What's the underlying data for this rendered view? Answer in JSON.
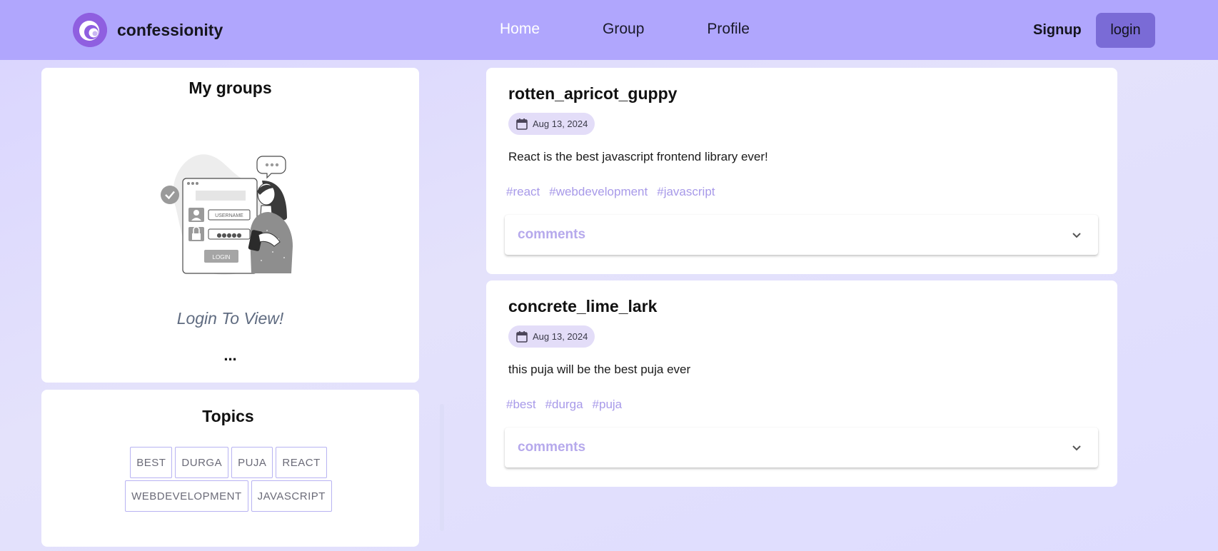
{
  "navbar": {
    "brand": "confessionity",
    "links": [
      {
        "label": "Home",
        "active": true
      },
      {
        "label": "Group",
        "active": false
      },
      {
        "label": "Profile",
        "active": false
      }
    ],
    "signup_label": "Signup",
    "login_label": "login",
    "logo_icon": "swirl-logo-icon"
  },
  "groups": {
    "title": "My groups",
    "illustration": {
      "username_text": "USERNAME",
      "password_mask": "●●●●●",
      "login_text": "LOGIN"
    },
    "message": "Login To View!",
    "more": "..."
  },
  "topics": {
    "title": "Topics",
    "items": [
      "BEST",
      "DURGA",
      "PUJA",
      "REACT",
      "WEBDEVELOPMENT",
      "JAVASCRIPT"
    ]
  },
  "posts": [
    {
      "username": "rotten_apricot_guppy",
      "date": "Aug 13, 2024",
      "text": "React is the best javascript frontend library ever!",
      "tags": [
        "#react",
        "#webdevelopment",
        "#javascript"
      ],
      "comments_label": "comments"
    },
    {
      "username": "concrete_lime_lark",
      "date": "Aug 13, 2024",
      "text": "this puja will be the best puja ever",
      "tags": [
        "#best",
        "#durga",
        "#puja"
      ],
      "comments_label": "comments"
    }
  ],
  "colors": {
    "navbar": "#b0a6fd",
    "accent": "#7a6bd6",
    "tag": "#a89ae9",
    "comments": "#b6a9ec"
  }
}
